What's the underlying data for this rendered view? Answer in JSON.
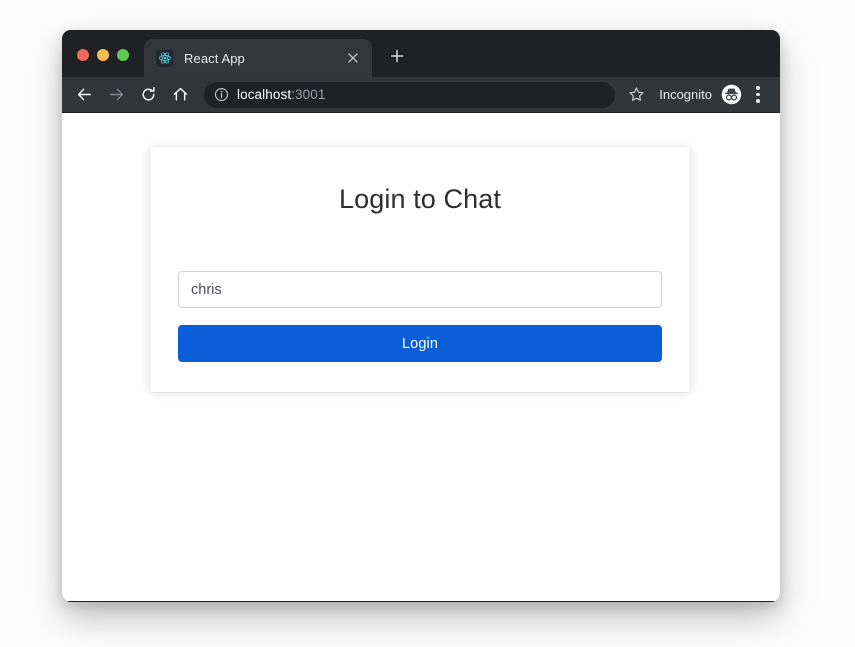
{
  "window": {
    "traffic_lights": [
      {
        "name": "close",
        "color": "#ed6a5e"
      },
      {
        "name": "minimize",
        "color": "#f5bd4f"
      },
      {
        "name": "maximize",
        "color": "#61c554"
      }
    ]
  },
  "tabs": {
    "active": {
      "title": "React App",
      "favicon": "react-logo-icon",
      "close_label": "×"
    },
    "new_tab_label": "+"
  },
  "toolbar": {
    "back_icon": "arrow-left-icon",
    "forward_icon": "arrow-right-icon",
    "reload_icon": "reload-icon",
    "home_icon": "home-icon",
    "info_icon": "info-circle-icon",
    "url_host": "localhost",
    "url_port": ":3001",
    "url_full": "localhost:3001",
    "star_icon": "star-icon",
    "profile_label": "Incognito",
    "profile_icon": "incognito-avatar-icon",
    "menu_icon": "three-dot-menu-icon"
  },
  "page": {
    "card": {
      "title": "Login to Chat",
      "username_value": "chris",
      "username_placeholder": "chris",
      "login_button_label": "Login"
    },
    "colors": {
      "accent": "#0b5ed7",
      "title_text": "#2e2e2e",
      "input_border": "#ced4da",
      "card_background": "#ffffff"
    }
  }
}
